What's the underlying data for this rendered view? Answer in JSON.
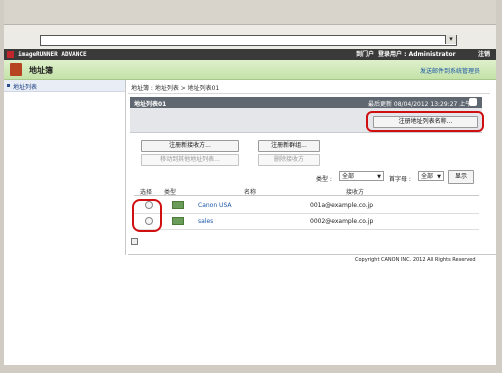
{
  "browser": {
    "dropdown_symbol": "▾"
  },
  "appbar": {
    "brand": "imageRUNNER ADVANCE",
    "portal": "到门户",
    "login": "登录用户 : Administrator",
    "logout": "注销"
  },
  "titlebar": {
    "title": "地址簿",
    "manager": "发送邮件到系统管理员"
  },
  "sidebar": {
    "items": [
      {
        "label": "地址列表"
      }
    ]
  },
  "main": {
    "breadcrumb": "地址簿 : 地址列表 > 地址列表01",
    "panel": {
      "title": "地址列表01",
      "updated": "最后更新   08/04/2012 13:29:27 上午"
    },
    "buttons": {
      "rename": "注册地址列表名称...",
      "add_destination": "注册新接收方...",
      "add_group": "注册新群组...",
      "move": "移动到其他地址列表...",
      "delete": "删除接收方"
    },
    "filter": {
      "type_label": "类型 :",
      "type_value": "全部",
      "initial_label": "首字母 :",
      "initial_value": "全部",
      "show": "显示"
    },
    "table": {
      "headers": {
        "select": "选择",
        "type": "类型",
        "name": "名称",
        "destination": "接收方"
      },
      "rows": [
        {
          "name": "Canon USA",
          "destination": "001a@example.co.jp"
        },
        {
          "name": "sales",
          "destination": "0002@example.co.jp"
        }
      ]
    }
  },
  "footer": {
    "copyright": "Copyright CANON INC. 2012 All Rights Reserved"
  },
  "colors": {
    "highlight": "#d01010",
    "appbar": "#3a3a3a",
    "titlebar": "#c4e2a8",
    "link": "#1a55a8"
  }
}
